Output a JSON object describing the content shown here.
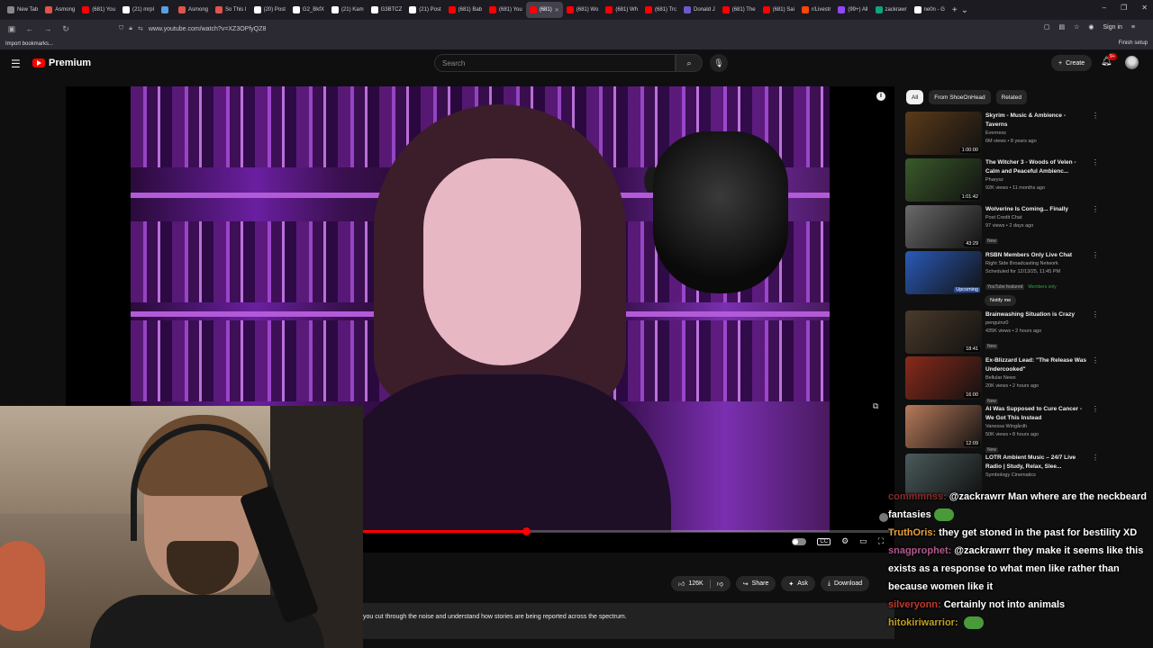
{
  "browser": {
    "tabs": [
      {
        "label": "New Tab",
        "color": "#888888"
      },
      {
        "label": "Asmong",
        "color": "#e0544a"
      },
      {
        "label": "(681) You",
        "color": "#ff0000"
      },
      {
        "label": "(21) mrpl",
        "color": "#ffffff"
      },
      {
        "label": "",
        "color": "#5aa0e0"
      },
      {
        "label": "Asmong",
        "color": "#e0544a"
      },
      {
        "label": "So This I",
        "color": "#e0544a"
      },
      {
        "label": "(20) Post",
        "color": "#ffffff"
      },
      {
        "label": "G2_BkfX",
        "color": "#ffffff"
      },
      {
        "label": "(21) Kam",
        "color": "#ffffff"
      },
      {
        "label": "G3BTCZ",
        "color": "#ffffff"
      },
      {
        "label": "(21) Post",
        "color": "#ffffff"
      },
      {
        "label": "(681) Bab",
        "color": "#ff0000"
      },
      {
        "label": "(681) You",
        "color": "#ff0000"
      },
      {
        "label": "(681)",
        "color": "#ff0000",
        "active": true
      },
      {
        "label": "(681) Wo",
        "color": "#ff0000"
      },
      {
        "label": "(681) Wh",
        "color": "#ff0000"
      },
      {
        "label": "(681) Trc",
        "color": "#ff0000"
      },
      {
        "label": "Donald J",
        "color": "#6a5acd"
      },
      {
        "label": "(681) The",
        "color": "#ff0000"
      },
      {
        "label": "(681) Sai",
        "color": "#ff0000"
      },
      {
        "label": "r/Livestr",
        "color": "#ff4500"
      },
      {
        "label": "(99+) All",
        "color": "#9146ff"
      },
      {
        "label": "zackrawr",
        "color": "#10a37f"
      },
      {
        "label": "ne0n - G",
        "color": "#ffffff"
      }
    ],
    "url": "www.youtube.com/watch?v=XZ3OPfyQZ8",
    "sign_in": "Sign in",
    "finish_setup": "Finish setup",
    "import_bookmarks": "Import bookmarks..."
  },
  "header": {
    "logo_text": "Premium",
    "search_placeholder": "Search",
    "create_label": "Create",
    "notif_count": "9+"
  },
  "player": {
    "progress_fraction": 0.555
  },
  "actions": {
    "likes": "126K",
    "share": "Share",
    "ask": "Ask",
    "download": "Download"
  },
  "description": {
    "text": "you cut through the noise and understand how stories are being reported across the spectrum."
  },
  "sidebar": {
    "chips": [
      "All",
      "From ShoeOnHead",
      "Related"
    ],
    "recommendations": [
      {
        "title": "Skyrim - Music & Ambience - Taverns",
        "channel": "Everness",
        "meta": "6M views • 8 years ago",
        "duration": "1:00:00",
        "thumb": "#5a3a1a"
      },
      {
        "title": "The Witcher 3 - Woods of Velen - Calm and Peaceful Ambienc...",
        "channel": "Pharysz",
        "meta": "92K views • 11 months ago",
        "duration": "1:01:42",
        "thumb": "#3a5a2a"
      },
      {
        "title": "Wolverine Is Coming... Finally",
        "channel": "Post Credit Chat",
        "meta": "97 views • 2 days ago",
        "badge": "New",
        "duration": "43:29",
        "thumb": "#6a6a6a"
      },
      {
        "title": "RSBN Members Only Live Chat",
        "channel": "Right Side Broadcasting Network",
        "meta": "Scheduled for 12/13/25, 11:45 PM",
        "badge": "YouTube featured",
        "members": "Members only",
        "duration": "Upcoming",
        "thumb": "#2a5ab8"
      },
      {
        "title": "Brainwashing Situation is Crazy",
        "channel": "penguinz0",
        "meta": "435K views • 2 hours ago",
        "badge": "New",
        "duration": "18:41",
        "thumb": "#4a3a2a"
      },
      {
        "title": "Ex-Blizzard Lead: \"The Release Was Undercooked\"",
        "channel": "Bellular News",
        "meta": "20K views • 2 hours ago",
        "badge": "New",
        "duration": "16:00",
        "thumb": "#8a2a1a"
      },
      {
        "title": "AI Was Supposed to Cure Cancer - We Got This Instead",
        "channel": "Vanessa Wingårdh",
        "meta": "50K views • 8 hours ago",
        "badge": "New",
        "duration": "12:09",
        "thumb": "#b87a5a"
      },
      {
        "title": "LOTR Ambient Music – 24/7 Live Radio | Study, Relax, Slee...",
        "channel": "Symbology Cinematics",
        "meta": "",
        "duration": "",
        "thumb": "#4a5a5a"
      }
    ],
    "notify_label": "Notify me"
  },
  "chat": [
    {
      "user": "commmnss:",
      "user_color": "#8b2a2a",
      "message": "@zackrawrr Man where are the neckbeard fantasies",
      "emote": true
    },
    {
      "user": "TruthOris:",
      "user_color": "#e8a03a",
      "message": "they get stoned in the past for bestility XD"
    },
    {
      "user": "snagprophet:",
      "user_color": "#b05a8a",
      "message": "@zackrawrr they make it seems like this exists as a response to what men like rather than because women like it"
    },
    {
      "user": "silveryonn:",
      "user_color": "#c0392b",
      "message": "Certainly not into animals"
    },
    {
      "user": "hitokiriwarrior:",
      "user_color": "#c0a020",
      "message": "",
      "emote": true
    }
  ]
}
